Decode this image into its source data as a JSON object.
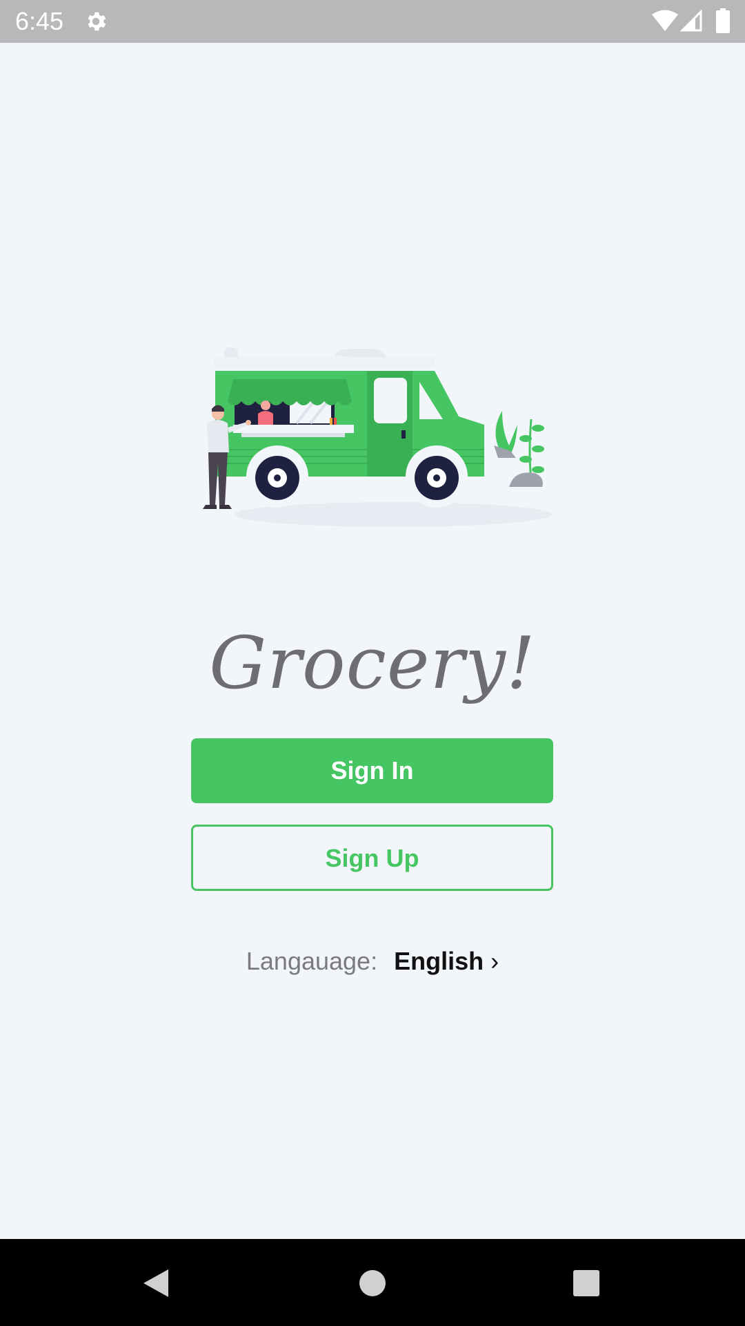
{
  "status_bar": {
    "time": "6:45",
    "icons": [
      "gear-icon",
      "wifi-icon",
      "signal-icon",
      "battery-icon"
    ]
  },
  "app": {
    "title": "Grocery!"
  },
  "buttons": {
    "sign_in": "Sign In",
    "sign_up": "Sign Up"
  },
  "language": {
    "label": "Langauage:",
    "value": "English",
    "chevron": "›"
  },
  "nav_bar": {
    "icons": [
      "back-icon",
      "home-icon",
      "recents-icon"
    ]
  },
  "colors": {
    "accent": "#46c663",
    "background": "#f2f5f9",
    "status_bar": "#b7b8ba",
    "nav_bar": "#000000",
    "title_text": "#6d6d72"
  }
}
